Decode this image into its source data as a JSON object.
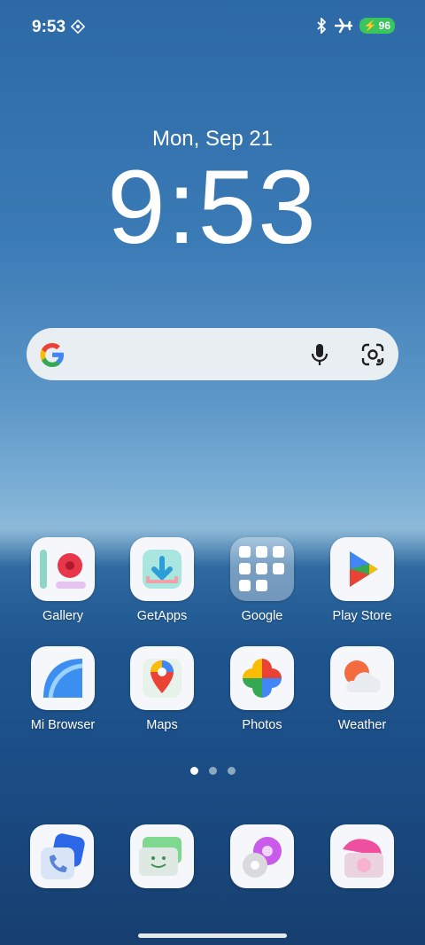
{
  "status_bar": {
    "time": "9:53",
    "battery": "96"
  },
  "lock": {
    "date": "Mon, Sep 21",
    "clock": "9:53"
  },
  "apps": [
    {
      "label": "Gallery"
    },
    {
      "label": "GetApps"
    },
    {
      "label": "Google"
    },
    {
      "label": "Play Store"
    },
    {
      "label": "Mi Browser"
    },
    {
      "label": "Maps"
    },
    {
      "label": "Photos"
    },
    {
      "label": "Weather"
    }
  ],
  "page_indicator": {
    "pages": 3,
    "active": 1
  }
}
